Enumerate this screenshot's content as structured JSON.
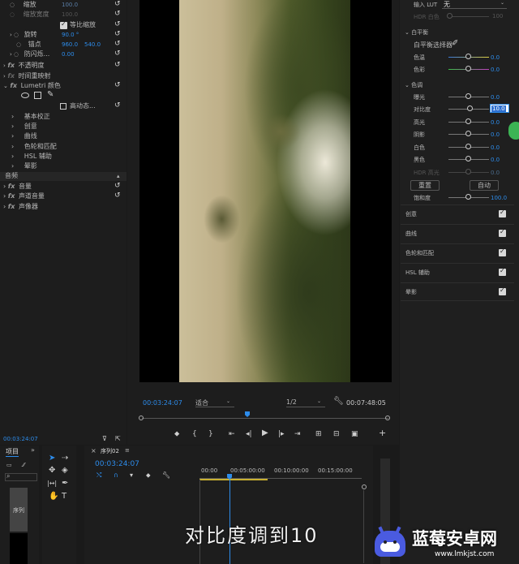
{
  "effects": {
    "scale_label": "缩放",
    "scale_value": "100.0",
    "scale_width_label": "缩放宽度",
    "scale_width_value": "100.0",
    "uniform_scale_label": "等比缩放",
    "rotation_label": "旋转",
    "rotation_value": "90.0 °",
    "anchor_label": "锚点",
    "anchor_x": "960.0",
    "anchor_y": "540.0",
    "antiflicker_label": "防闪烁...",
    "antiflicker_value": "0.00",
    "opacity_label": "不透明度",
    "time_remap_label": "时间重映射",
    "lumetri_label": "Lumetri 颜色",
    "hdr_label": "高动态...",
    "basic_label": "基本校正",
    "creative_label": "创意",
    "curves_label": "曲线",
    "wheels_label": "色轮和匹配",
    "hsl_label": "HSL 辅助",
    "vignette_label": "晕影",
    "audio_header": "音频",
    "volume_label": "音量",
    "channel_volume_label": "声道音量",
    "panner_label": "声像器",
    "timecode": "00:03:24:07"
  },
  "monitor": {
    "timecode": "00:03:24:07",
    "fit_label": "适合",
    "resolution": "1/2",
    "duration": "00:07:48:05"
  },
  "lumetri": {
    "input_lut_label": "输入 LUT",
    "input_lut_value": "无",
    "hdr_white_label": "HDR 白色",
    "hdr_white_value": "100",
    "white_balance_label": "白平衡",
    "wb_selector_label": "白平衡选择器",
    "temperature_label": "色温",
    "temperature_value": "0.0",
    "tint_label": "色彩",
    "tint_value": "0.0",
    "tone_label": "色调",
    "exposure_label": "曝光",
    "exposure_value": "0.0",
    "contrast_label": "对比度",
    "contrast_value": "10.0",
    "highlights_label": "高光",
    "highlights_value": "0.0",
    "shadows_label": "阴影",
    "shadows_value": "0.0",
    "whites_label": "白色",
    "whites_value": "0.0",
    "blacks_label": "黑色",
    "blacks_value": "0.0",
    "hdr_specular_label": "HDR 高光",
    "hdr_specular_value": "0.0",
    "reset_label": "重置",
    "auto_label": "自动",
    "saturation_label": "饱和度",
    "saturation_value": "100.0",
    "sections": [
      "创意",
      "曲线",
      "色轮和匹配",
      "HSL 辅助",
      "晕影"
    ]
  },
  "project": {
    "tab_label": "项目",
    "item_label": "序列"
  },
  "timeline": {
    "tab_label": "序列02",
    "timecode": "00:03:24:07",
    "ruler": [
      "00:00",
      "00:05:00:00",
      "00:10:00:00",
      "00:15:00:00"
    ]
  },
  "overlay": {
    "subtitle": "对比度调到10",
    "watermark_brand": "蓝莓安卓网",
    "watermark_url": "www.lmkjst.com"
  }
}
